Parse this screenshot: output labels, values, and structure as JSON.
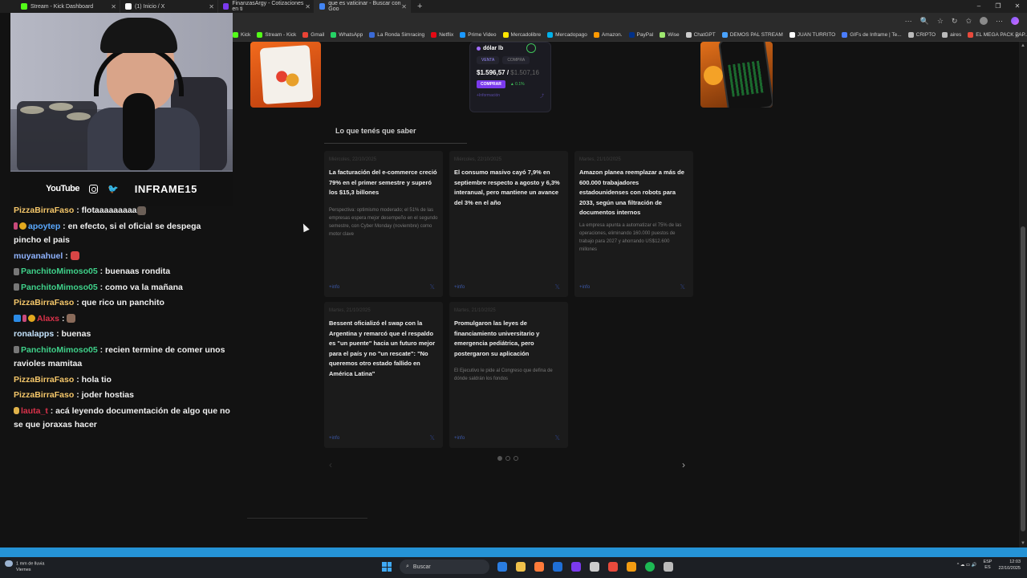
{
  "browser": {
    "tabs": [
      {
        "label": "Stream - Kick Dashboard",
        "color": "#53fc18",
        "active": false
      },
      {
        "label": "(1) Inicio / X",
        "color": "#ffffff",
        "active": false
      },
      {
        "label": "FinanzasArgy - Cotizaciones en ti",
        "color": "#7b3aed",
        "active": false
      },
      {
        "label": "que es vaticinar - Buscar con Goo",
        "color": "#4285f4",
        "active": true
      }
    ],
    "new_tab": "+",
    "window_controls": [
      "–",
      "❐",
      "✕"
    ],
    "toolbar_icons": [
      "⋯",
      "🔍",
      "☆",
      "↻",
      "✩"
    ],
    "bookmarks": [
      {
        "label": "Kick",
        "color": "#53fc18"
      },
      {
        "label": "Stream - Kick",
        "color": "#53fc18"
      },
      {
        "label": "Gmail",
        "color": "#ea4335"
      },
      {
        "label": "WhatsApp",
        "color": "#25d366"
      },
      {
        "label": "La Ronda Simracing",
        "color": "#3a6ad6"
      },
      {
        "label": "Netflix",
        "color": "#e50914"
      },
      {
        "label": "Prime Video",
        "color": "#1a98ff"
      },
      {
        "label": "Mercadolibre",
        "color": "#ffe600"
      },
      {
        "label": "Mercadopago",
        "color": "#00b1ea"
      },
      {
        "label": "Amazon.",
        "color": "#ff9900"
      },
      {
        "label": "PayPal",
        "color": "#003087"
      },
      {
        "label": "Wise",
        "color": "#9fe870"
      },
      {
        "label": "ChatGPT",
        "color": "#cccccc"
      },
      {
        "label": "DEMOS PAL STREAM",
        "color": "#4aa3ff"
      },
      {
        "label": "JUAN TURRITO",
        "color": "#ffffff"
      },
      {
        "label": "GIFs de Inframe | Te...",
        "color": "#4a7dff"
      },
      {
        "label": "CRIPTO",
        "color": "#bbbbbb"
      },
      {
        "label": "aires",
        "color": "#bbbbbb"
      },
      {
        "label": "EL MEGA PACK PAP...",
        "color": "#e84a3c"
      }
    ],
    "bookmarks_more": "»"
  },
  "dolar_widget": {
    "title": "dólar lb",
    "tab_sell": "VENTA",
    "tab_buy": "COMPRA",
    "price_sell": "$1.596,57",
    "separator": "/",
    "price_buy": "$1.507,16",
    "buy_button": "COMPRAR",
    "change": "▲ 0.1%",
    "more_info": "+Información",
    "share_icon": "⤴"
  },
  "news_section": {
    "title": "Lo que tenés que saber",
    "more_label": "+info",
    "cards": [
      {
        "date": "Miércoles, 22/10/2025",
        "headline": "La facturación del e-commerce creció 79% en el primer semestre y superó los $15,3 billones",
        "summary": "Perspectiva: optimismo moderado; el 51% de las empresas espera mejor desempeño en el segundo semestre, con Cyber Monday (noviembre) como motor clave"
      },
      {
        "date": "Miércoles, 22/10/2025",
        "headline": "El consumo masivo cayó 7,9% en septiembre respecto a agosto y 6,3% interanual, pero mantiene un avance del 3% en el año",
        "summary": ""
      },
      {
        "date": "Martes, 21/10/2025",
        "headline": "Amazon planea reemplazar a más de 600.000 trabajadores estadounidenses con robots para 2033, según una filtración de documentos internos",
        "summary": "La empresa apunta a automatizar el 75% de las operaciones, eliminando 160.000 puestos de trabajo para 2027 y ahorrando US$12.600 millones"
      },
      {
        "date": "Martes, 21/10/2025",
        "headline": "Bessent oficializó el swap con la Argentina y remarcó que el respaldo es \"un puente\" hacia un futuro mejor para el país y no \"un rescate\": \"No queremos otro estado fallido en América Latina\"",
        "summary": ""
      },
      {
        "date": "Martes, 21/10/2025",
        "headline": "Promulgaron las leyes de financiamiento universitario y emergencia pediátrica, pero postergaron su aplicación",
        "summary": "El Ejecutivo le pide al Congreso que defina de dónde saldrán los fondos"
      }
    ],
    "prev": "‹",
    "next": "›"
  },
  "stream": {
    "socials_label": "YouTube",
    "twitter_icon": "🐦",
    "handle": "INFRAME15"
  },
  "chat": [
    {
      "user": "PizzaBirraFaso",
      "color": "#f5c76a",
      "text": " : flotaaaaaaaaa",
      "badges": [],
      "emote": "#6b5f57"
    },
    {
      "user": "apoytep",
      "color": "#5aa9ff",
      "text": " : en efecto, si el oficial se despega pincho el pais",
      "badges": [
        "sub",
        "gold"
      ],
      "emote": ""
    },
    {
      "user": "muyanahuel",
      "color": "#8fb3ff",
      "text": " : ",
      "badges": [],
      "emote": "#d94545"
    },
    {
      "user": "PanchitoMimoso05",
      "color": "#3fd18a",
      "text": " : buenaas rondita",
      "badges": [
        "gray"
      ],
      "emote": ""
    },
    {
      "user": "PanchitoMimoso05",
      "color": "#3fd18a",
      "text": " : como va la mañana",
      "badges": [
        "gray"
      ],
      "emote": ""
    },
    {
      "user": "PizzaBirraFaso",
      "color": "#f5c76a",
      "text": " : que rico un panchito",
      "badges": [],
      "emote": ""
    },
    {
      "user": "Alaxs",
      "color": "#d9324a",
      "text": " : ",
      "badges": [
        "blue",
        "sub",
        "gold"
      ],
      "emote": "#8a6b5a"
    },
    {
      "user": "ronalapps",
      "color": "#c6e5ff",
      "text": " : buenas",
      "badges": [],
      "emote": ""
    },
    {
      "user": "PanchitoMimoso05",
      "color": "#3fd18a",
      "text": " : recien termine de comer unos ravioles mamitaa",
      "badges": [
        "gray"
      ],
      "emote": ""
    },
    {
      "user": "PizzaBirraFaso",
      "color": "#f5c76a",
      "text": " : hola tio",
      "badges": [],
      "emote": ""
    },
    {
      "user": "PizzaBirraFaso",
      "color": "#f5c76a",
      "text": " : joder hostias",
      "badges": [],
      "emote": ""
    },
    {
      "user": "lauta_t",
      "color": "#d9324a",
      "text": " : acá leyendo documentación de algo que no se que joraxas hacer",
      "badges": [
        "hand"
      ],
      "emote": ""
    }
  ],
  "progress": {
    "value": 1.0,
    "color": "#2593d6"
  },
  "taskbar": {
    "weather_line1": "1 mm de lluvia",
    "weather_line2": "Viernes",
    "search_placeholder": "Buscar",
    "apps": [
      "#2a7de1",
      "#f0c14b",
      "#ff7b3a",
      "#1f6fd6",
      "#7b3aed",
      "#cccccc",
      "#e84a3c",
      "#f39c12",
      "#1db954",
      "#bbbbbb"
    ],
    "tray_icons": "^  ☁  ▭  🔊",
    "lang_line1": "ESP",
    "lang_line2": "ES",
    "time": "12:03",
    "date": "22/10/2025"
  }
}
